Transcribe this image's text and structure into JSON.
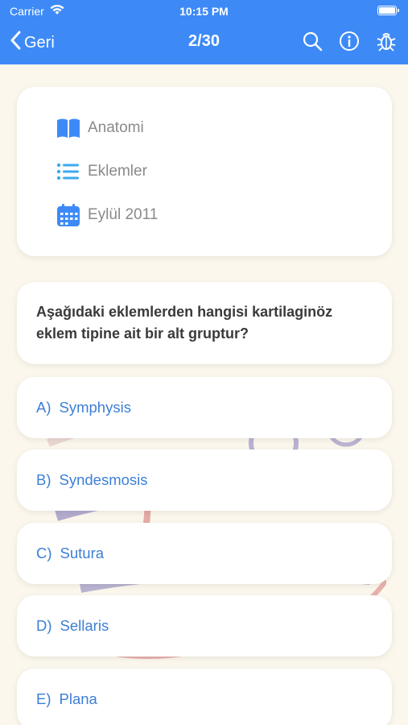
{
  "status_bar": {
    "carrier": "Carrier",
    "time": "10:15 PM"
  },
  "nav": {
    "back_label": "Geri",
    "title": "2/30",
    "icons": [
      "search-icon",
      "info-icon",
      "bug-icon"
    ]
  },
  "info": {
    "subject": "Anatomi",
    "topic": "Eklemler",
    "date": "Eylül 2011"
  },
  "question": {
    "text": "Aşağıdaki eklemlerden hangisi kartilaginöz eklem tipine ait bir alt gruptur?"
  },
  "options": [
    {
      "letter": "A)",
      "text": "Symphysis"
    },
    {
      "letter": "B)",
      "text": "Syndesmosis"
    },
    {
      "letter": "C)",
      "text": "Sutura"
    },
    {
      "letter": "D)",
      "text": "Sellaris"
    },
    {
      "letter": "E)",
      "text": "Plana"
    }
  ],
  "colors": {
    "header": "#3d8af7",
    "background": "#fbf7ec",
    "option_text": "#3d7fd6",
    "info_icon": "#3d8af7"
  }
}
